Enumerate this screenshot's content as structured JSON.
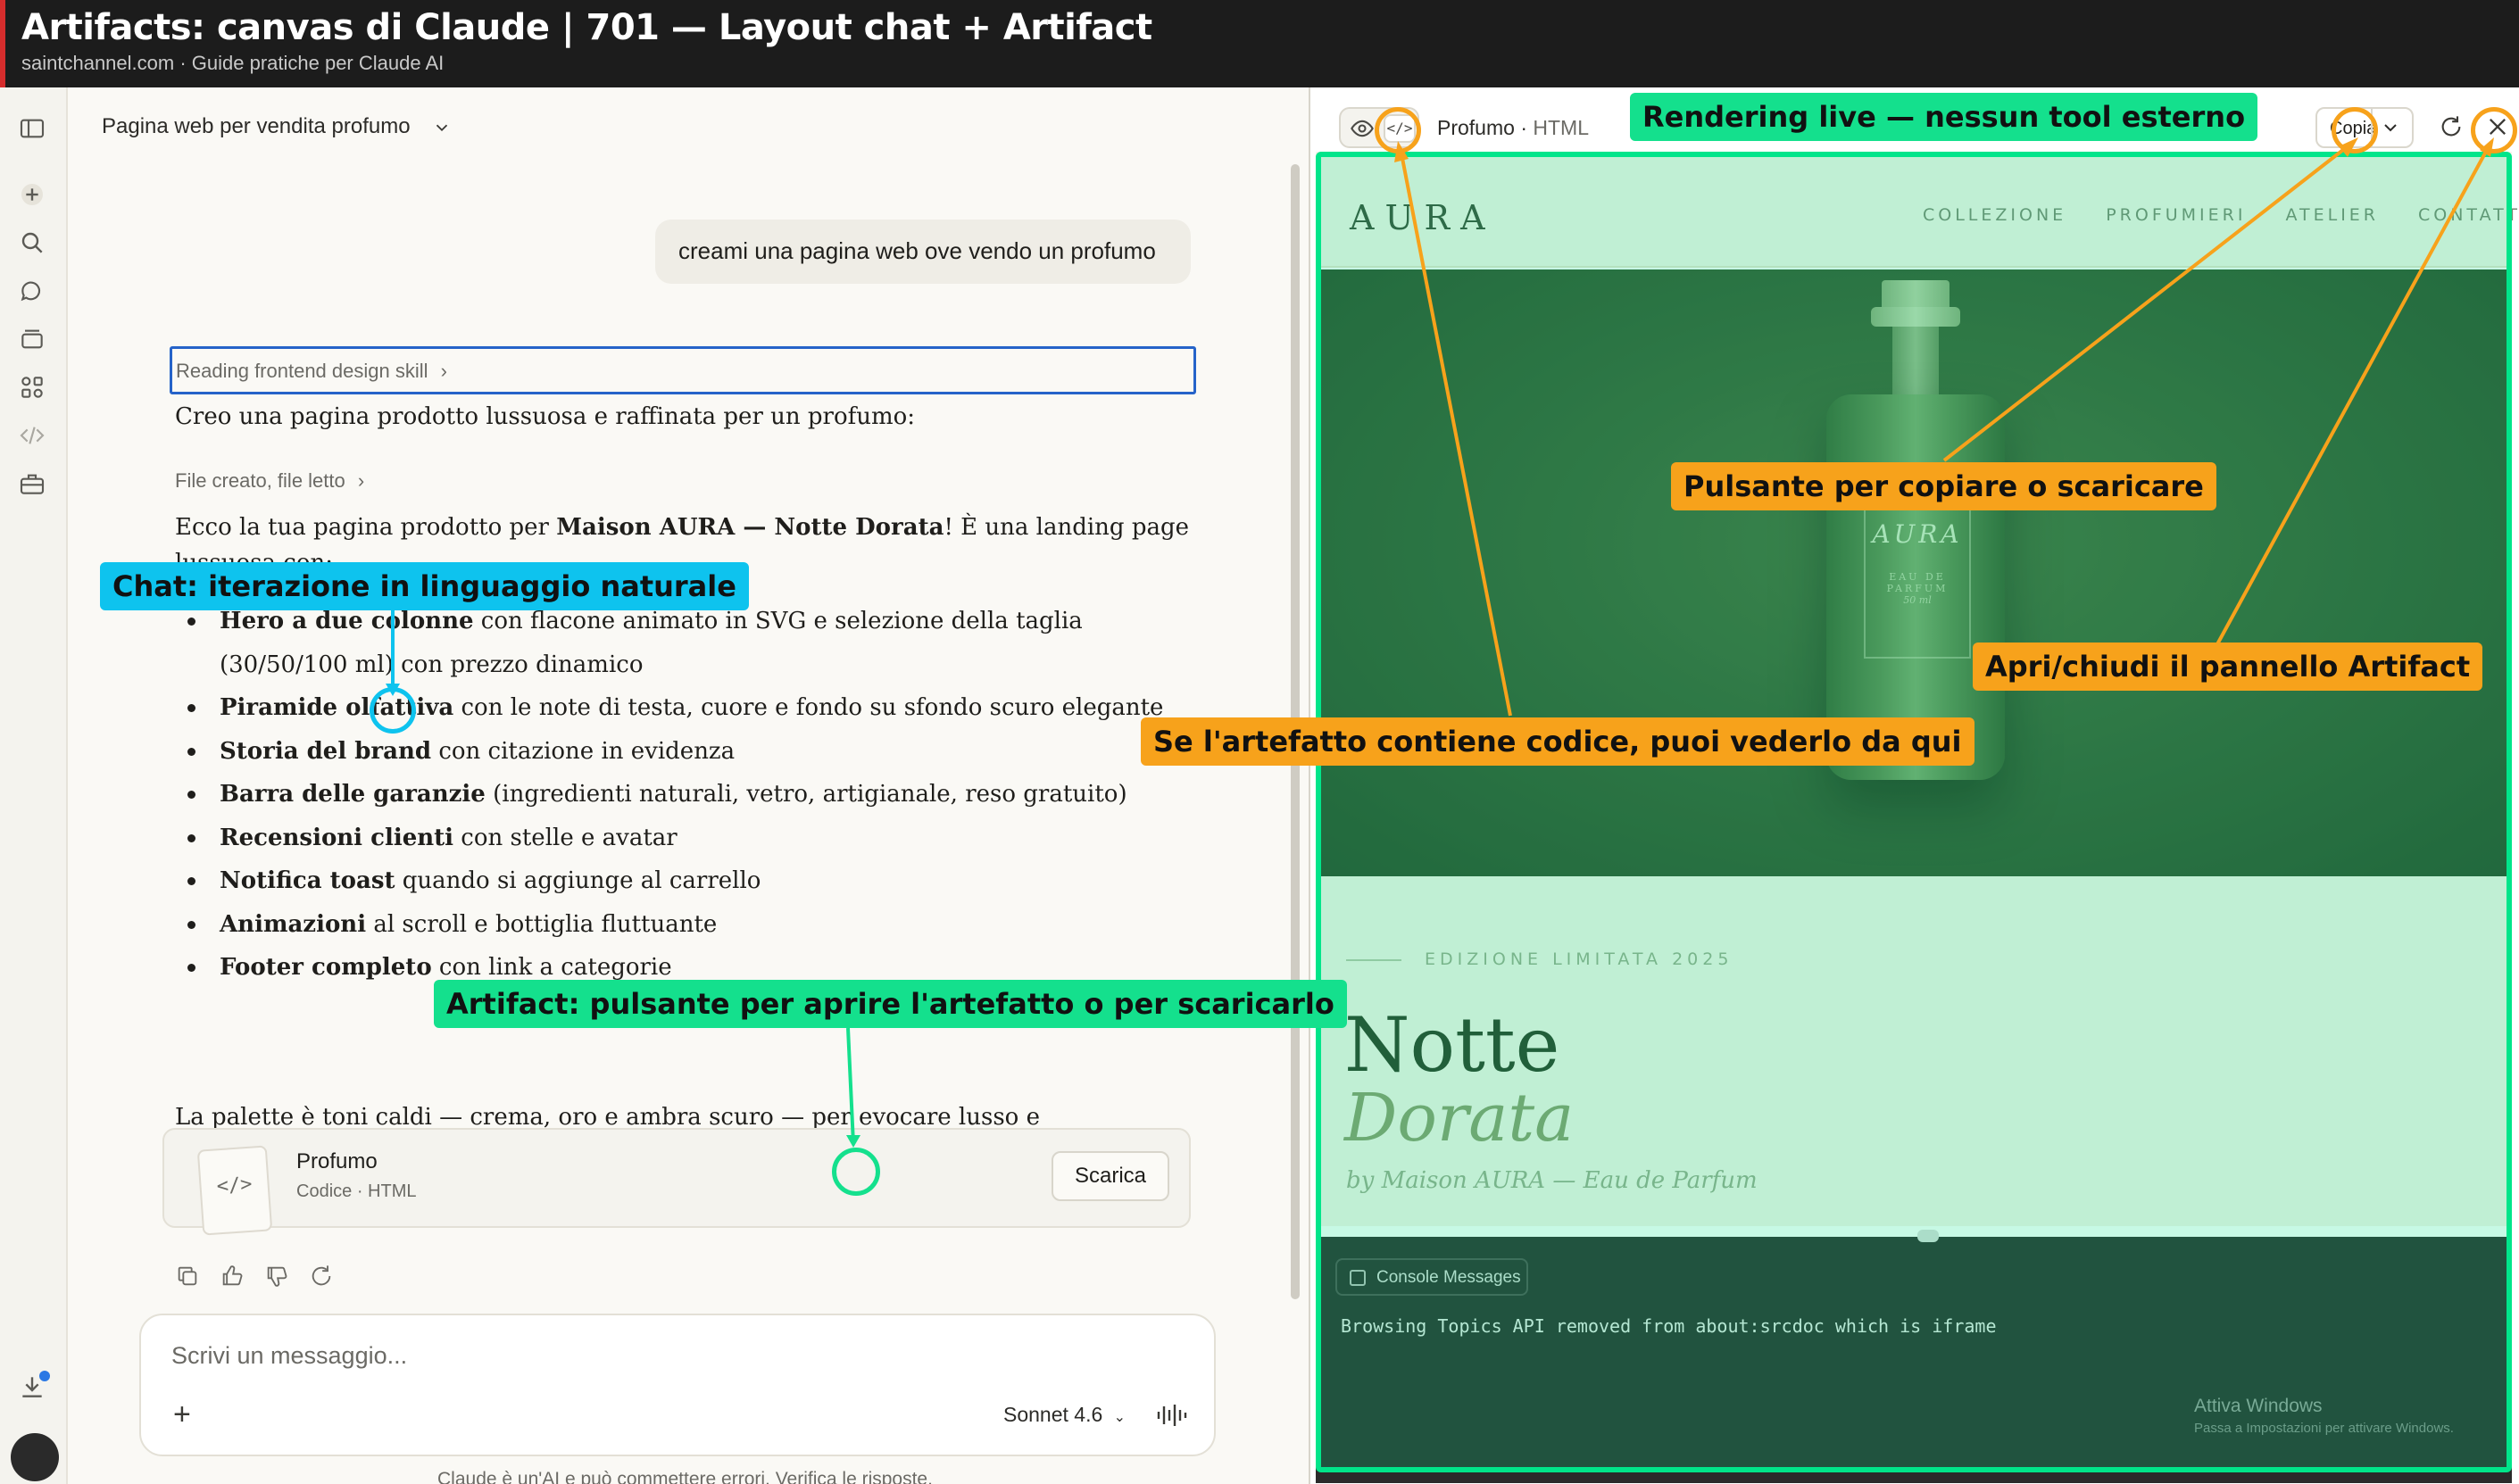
{
  "banner": {
    "title": "Artifacts: canvas di Claude | 701 — Layout chat + Artifact",
    "subtitle": "saintchannel.com · Guide pratiche per Claude AI"
  },
  "chat": {
    "conversation_title": "Pagina web per vendita profumo",
    "user_message": "creami una pagina web ove vendo un profumo",
    "skill_line": "Reading frontend design skill",
    "intro": "Creo una pagina prodotto lussuosa e raffinata per un profumo:",
    "file_line": "File creato, file letto",
    "summary_prefix": "Ecco la tua pagina prodotto per ",
    "summary_bold": "Maison AURA — Notte Dorata",
    "summary_suffix": "! È una landing page",
    "summary_line2": "lussuosa con:",
    "bullets": [
      {
        "bold": "Hero a due colonne",
        "text": " con flacone animato in SVG e selezione della taglia (30/50/100 ml) con prezzo dinamico"
      },
      {
        "bold": "Piramide olfattiva",
        "text": " con le note di testa, cuore e fondo su sfondo scuro elegante"
      },
      {
        "bold": "Storia del brand",
        "text": " con citazione in evidenza"
      },
      {
        "bold": "Barra delle garanzie",
        "text": " (ingredienti naturali, vetro, artigianale, reso gratuito)"
      },
      {
        "bold": "Recensioni clienti",
        "text": " con stelle e avatar"
      },
      {
        "bold": "Notifica toast",
        "text": " quando si aggiunge al carrello"
      },
      {
        "bold": "Animazioni",
        "text": " al scroll e bottiglia fluttuante"
      },
      {
        "bold": "Footer completo",
        "text": " con link a categorie"
      }
    ],
    "closing": "La palette è toni caldi — crema, oro e ambra scuro — per evocare lusso e sensorialità mediterranea. Vuoi cambiare il nome del profumo, i colori, i prezzi o aggiungere altre sezioni?",
    "artifact_card": {
      "title": "Profumo",
      "subtitle": "Codice · HTML",
      "download_label": "Scarica",
      "thumb_glyph": "</>"
    },
    "composer": {
      "placeholder": "Scrivi un messaggio...",
      "model": "Sonnet 4.6",
      "plus": "+"
    },
    "disclaimer": "Claude è un'AI e può commettere errori. Verifica le risposte."
  },
  "artifact": {
    "name": "Profumo",
    "type": "HTML",
    "copy_label": "Copia",
    "code_glyph": "</>",
    "site": {
      "logo": "AURA",
      "nav": [
        "COLLEZIONE",
        "PROFUMIERI",
        "ATELIER",
        "CONTATTI"
      ],
      "bottle_brand": "AURA",
      "bottle_sub": "EAU DE PARFUM",
      "bottle_size": "50 ml",
      "edition": "EDIZIONE LIMITATA 2025",
      "headline_1": "Notte",
      "headline_2": "Dorata",
      "byline": "by Maison AURA — Eau de Parfum"
    },
    "console": {
      "button": "Console Messages",
      "line": "Browsing Topics API removed from about:srcdoc which is iframe",
      "windows_1": "Attiva Windows",
      "windows_2": "Passa a Impostazioni per attivare Windows."
    }
  },
  "annotations": {
    "rendering": "Rendering live — nessun tool esterno",
    "copy_download": "Pulsante per copiare o scaricare",
    "open_close": "Apri/chiudi il pannello Artifact",
    "view_code": "Se l'artefatto contiene codice, puoi vederlo da qui",
    "chat_iter": "Chat: iterazione in linguaggio naturale",
    "artifact_btn": "Artifact: pulsante per aprire l'artefatto o per scaricarlo"
  },
  "colors": {
    "annotation_orange": "#f7a21b",
    "annotation_green": "#14e08d",
    "annotation_blue": "#0ec3ee",
    "selection_blue": "#2563c9"
  }
}
